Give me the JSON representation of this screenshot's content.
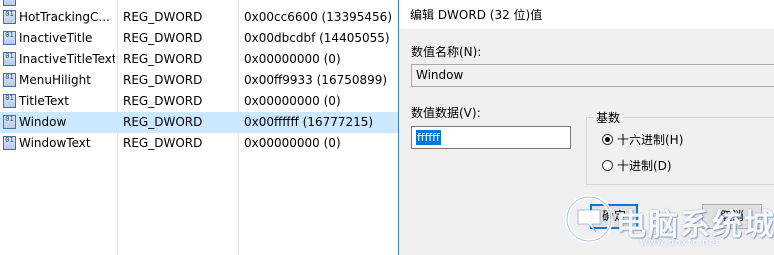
{
  "registry": {
    "rows": [
      {
        "name": "HotTrackingC...",
        "type": "REG_DWORD",
        "data": "0x00cc6600 (13395456)",
        "icon": "registry-value-icon"
      },
      {
        "name": "InactiveTitle",
        "type": "REG_DWORD",
        "data": "0x00dbcdbf (14405055)",
        "icon": "registry-value-icon"
      },
      {
        "name": "InactiveTitleText",
        "type": "REG_DWORD",
        "data": "0x00000000 (0)",
        "icon": "registry-value-icon"
      },
      {
        "name": "MenuHilight",
        "type": "REG_DWORD",
        "data": "0x00ff9933 (16750899)",
        "icon": "registry-value-icon"
      },
      {
        "name": "TitleText",
        "type": "REG_DWORD",
        "data": "0x00000000 (0)",
        "icon": "registry-value-icon"
      },
      {
        "name": "Window",
        "type": "REG_DWORD",
        "data": "0x00ffffff (16777215)",
        "icon": "registry-value-icon",
        "selected": true
      },
      {
        "name": "WindowText",
        "type": "REG_DWORD",
        "data": "0x00000000 (0)",
        "icon": "registry-value-icon"
      }
    ]
  },
  "dialog": {
    "title": "编辑 DWORD (32 位)值",
    "value_name_label": "数值名称(N):",
    "value_name": "Window",
    "value_data_label": "数值数据(V):",
    "value_data": "ffffff",
    "base_label": "基数",
    "radio_hex_label": "十六进制(H)",
    "radio_dec_label": "十进制(D)",
    "ok_label": "确定",
    "cancel_label": "取消"
  },
  "watermark": {
    "text": "电脑系统城",
    "url": "www.dnxtc.net"
  },
  "colors": {
    "selection": "#cce8ff",
    "accent": "#0078d7",
    "dialog_bg": "#f0f0f0"
  }
}
